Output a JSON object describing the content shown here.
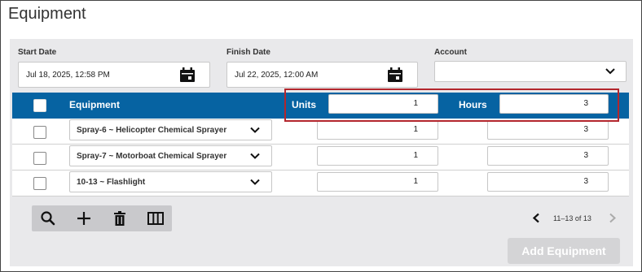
{
  "page": {
    "title": "Equipment"
  },
  "filters": {
    "start_date_label": "Start Date",
    "start_date_value": "Jul 18, 2025, 12:58 PM",
    "finish_date_label": "Finish Date",
    "finish_date_value": "Jul 22, 2025, 12:00 AM",
    "account_label": "Account",
    "account_value": ""
  },
  "table": {
    "header": {
      "equipment": "Equipment",
      "units": "Units",
      "units_default": "1",
      "hours": "Hours",
      "hours_default": "3"
    },
    "rows": [
      {
        "equipment": "Spray-6 ~ Helicopter Chemical Sprayer",
        "units": "1",
        "hours": "3"
      },
      {
        "equipment": "Spray-7 ~ Motorboat Chemical Sprayer",
        "units": "1",
        "hours": "3"
      },
      {
        "equipment": "10-13 ~ Flashlight",
        "units": "1",
        "hours": "3"
      }
    ]
  },
  "toolbar": {
    "icons": [
      "search-icon",
      "plus-icon",
      "trash-icon",
      "columns-icon"
    ]
  },
  "pager": {
    "range_text": "11–13 of 13"
  },
  "actions": {
    "add_label": "Add Equipment"
  },
  "colors": {
    "header_bg": "#0663a2",
    "panel_bg": "#e9e9eb",
    "highlight": "#b3262d",
    "disabled_button": "#d4d4d6"
  }
}
